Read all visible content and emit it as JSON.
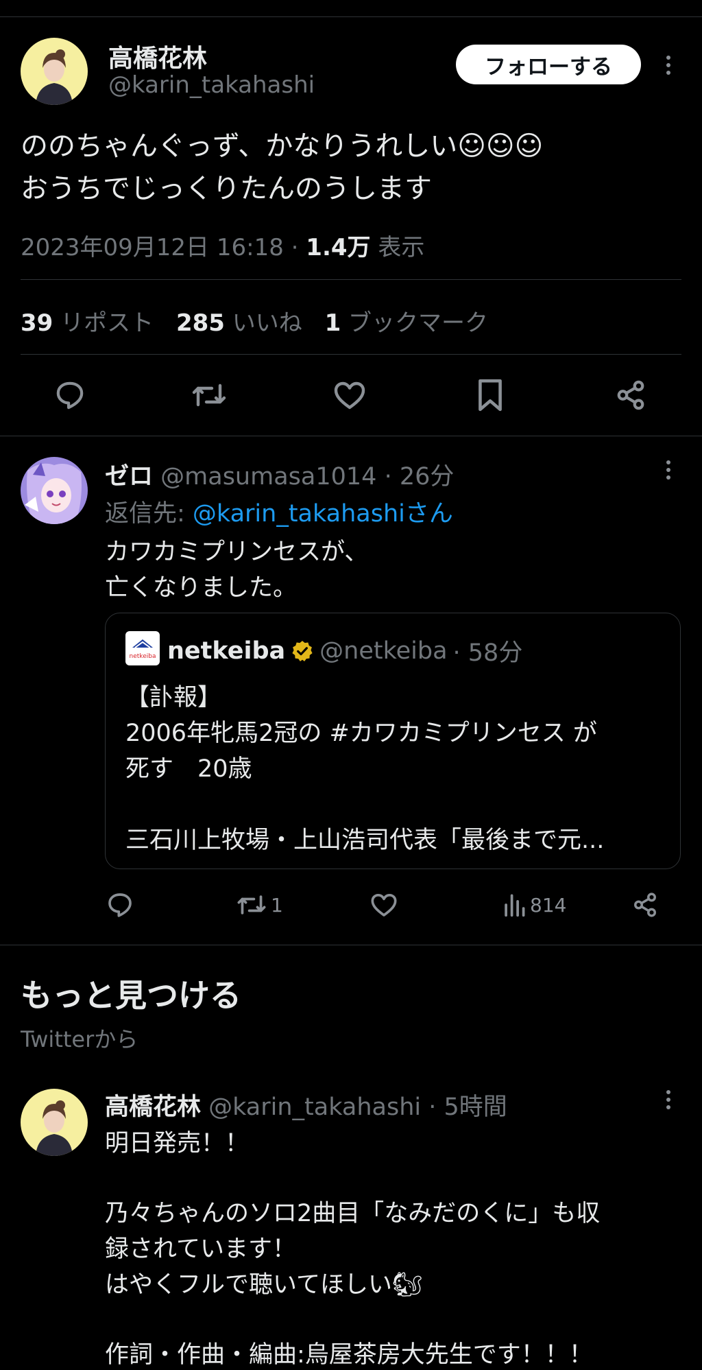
{
  "main_tweet": {
    "display_name": "高橋花林",
    "handle": "@karin_takahashi",
    "follow_label": "フォローする",
    "text_line1": "ののちゃんぐっず、かなりうれしい☺☺☺",
    "text_line2": "おうちでじっくりたんのうします",
    "timestamp": "2023年09月12日 16:18",
    "separator": "·",
    "views_count": "1.4万",
    "views_label": "表示",
    "retweets_count": "39",
    "retweets_label": "リポスト",
    "likes_count": "285",
    "likes_label": "いいね",
    "bookmarks_count": "1",
    "bookmarks_label": "ブックマーク",
    "actions": [
      "reply-icon",
      "retweet-icon",
      "like-icon",
      "bookmark-icon",
      "share-icon"
    ]
  },
  "reply": {
    "display_name": "ゼロ",
    "handle": "@masumasa1014",
    "time": "· 26分",
    "reply_to_prefix": "返信先: ",
    "reply_to_handle": "@karin_takahashiさん",
    "text_line1": "カワカミプリンセスが、",
    "text_line2": "亡くなりました。",
    "quote": {
      "logo_text": "netkeiba",
      "display_name": "netkeiba",
      "handle": "@netkeiba",
      "time": "· 58分",
      "line1": "【訃報】",
      "line2": "2006年牝馬2冠の #カワカミプリンセス が",
      "line3": "死す　20歳",
      "line4": "三石川上牧場・上山浩司代表「最後まで元..."
    },
    "retweet_count": "1",
    "views_count": "814"
  },
  "discover": {
    "title": "もっと見つける",
    "subtitle": "Twitterから"
  },
  "recommended": {
    "display_name": "高橋花林",
    "handle": "@karin_takahashi",
    "time": "· 5時間",
    "line1": "明日発売！！",
    "line2": "乃々ちゃんのソロ2曲目「なみだのくに」も収",
    "line3": "録されています！",
    "line4": "はやくフルで聴いてほしい🐿",
    "line5": "作詞・作曲・編曲:烏屋茶房大先生です！！！"
  },
  "colors": {
    "background": "#000000",
    "text": "#e7e9ea",
    "muted": "#71767b",
    "link": "#1d9bf0",
    "divider": "#2f3336",
    "verified": "#e2b719"
  }
}
